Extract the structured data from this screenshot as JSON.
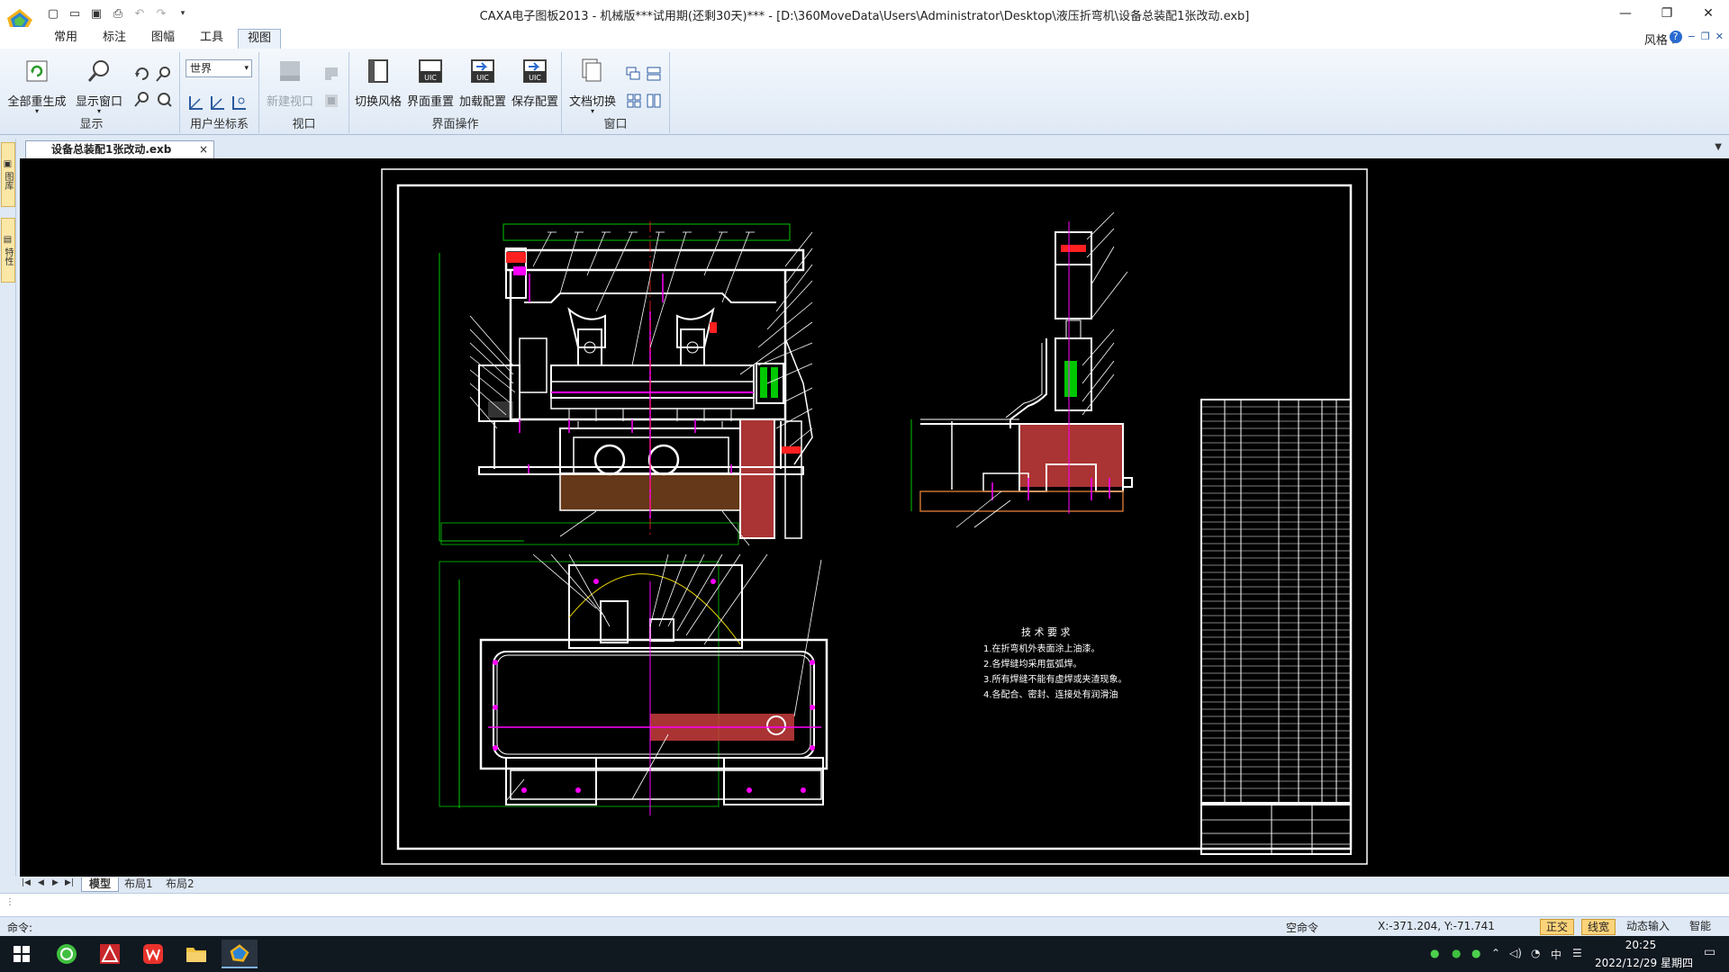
{
  "titlebar": {
    "title": "CAXA电子图板2013 - 机械版***试用期(还剩30天)*** - [D:\\360MoveData\\Users\\Administrator\\Desktop\\液压折弯机\\设备总装配1张改动.exb]",
    "minimize": "—",
    "restore": "❐",
    "close": "✕"
  },
  "menu": {
    "tabs": [
      "常用",
      "标注",
      "图幅",
      "工具",
      "视图"
    ],
    "active": "视图",
    "style_label": "风格",
    "help": "?"
  },
  "ribbon": {
    "groups": [
      {
        "label": "显示",
        "buttons": [
          "全部重生成",
          "显示窗口"
        ]
      },
      {
        "label": "用户坐标系",
        "select_value": "世界"
      },
      {
        "label": "视口",
        "buttons": [
          "新建视口"
        ]
      },
      {
        "label": "界面操作",
        "buttons": [
          "切换风格",
          "界面重置",
          "加载配置",
          "保存配置"
        ]
      },
      {
        "label": "窗口",
        "buttons": [
          "文档切换"
        ]
      }
    ]
  },
  "document": {
    "tab_name": "设备总装配1张改动.exb",
    "close": "×"
  },
  "leftpanel": {
    "tabs": [
      "图库",
      "特性"
    ]
  },
  "drawing": {
    "tech_title": "技 术 要 求",
    "tech_lines": [
      "1.在折弯机外表面涂上油漆。",
      "2.各焊缝均采用氩弧焊。",
      "3.所有焊缝不能有虚焊或夹渣现象。",
      "4.各配合、密封、连接处有润滑油"
    ]
  },
  "layouts": {
    "tabs": [
      "模型",
      "布局1",
      "布局2"
    ],
    "active": "模型"
  },
  "status": {
    "command_label": "命令:",
    "empty_command": "空命令",
    "coords": "X:-371.204, Y:-71.741",
    "toggles": [
      "正交",
      "线宽",
      "动态输入",
      "智能"
    ]
  },
  "taskbar": {
    "time": "20:25",
    "date": "2022/12/29 星期四",
    "ime": "中"
  },
  "colors": {
    "ribbon_bg": "#dfe9f5",
    "canvas_bg": "#000000",
    "line_white": "#ffffff",
    "line_magenta": "#ff00ff",
    "line_green": "#00c800",
    "line_red": "#ff2020",
    "line_yellow": "#e6d200"
  }
}
